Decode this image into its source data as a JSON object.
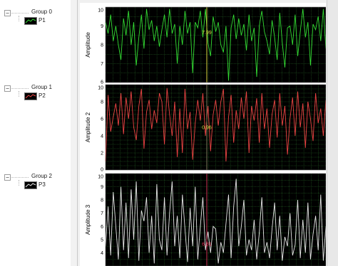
{
  "legend": {
    "groups": [
      {
        "name": "Group 0",
        "plot": "P1",
        "color": "#33dd33"
      },
      {
        "name": "Group 1",
        "plot": "P2",
        "color": "#ee4444"
      },
      {
        "name": "Group 2",
        "plot": "P3",
        "color": "#e8e8e8"
      }
    ]
  },
  "colors": {
    "plot_bg": "#000000",
    "grid": "#2a6e2a",
    "cursor_1": "#d8d840",
    "cursor_2": "#7a7a5a",
    "cursor_3": "#cc3355"
  },
  "chart_data": [
    {
      "type": "line",
      "ylabel": "Amplitude",
      "ylim": [
        6,
        10
      ],
      "yticks": [
        "10",
        "9",
        "8",
        "7",
        "6"
      ],
      "grid": true,
      "series": [
        {
          "name": "P1",
          "color": "#33dd33",
          "values": [
            9.2,
            8.6,
            9.6,
            8.2,
            9.0,
            8.0,
            7.2,
            9.4,
            8.5,
            9.8,
            8.0,
            9.2,
            6.9,
            8.4,
            9.6,
            7.8,
            9.9,
            8.8,
            9.3,
            8.2,
            9.0,
            7.9,
            8.8,
            9.6,
            8.4,
            9.9,
            8.6,
            9.1,
            7.0,
            9.0,
            8.0,
            9.8,
            8.6,
            9.2,
            6.5,
            9.2,
            8.9,
            9.8,
            8.4,
            9.9,
            8.1,
            7.4,
            9.5,
            8.7,
            9.2,
            8.0,
            7.6,
            9.0,
            6.1,
            8.9,
            9.6,
            8.3,
            9.4,
            8.5,
            9.1,
            7.7,
            9.6,
            8.2,
            8.9,
            6.3,
            9.0,
            9.8,
            8.7,
            8.2,
            7.5,
            9.3,
            8.4,
            7.2,
            9.7,
            8.1,
            6.8,
            8.9,
            9.0,
            8.0,
            9.6,
            7.4,
            8.7,
            9.9,
            8.4,
            9.2,
            6.9,
            9.1,
            8.8,
            9.5,
            8.2,
            9.9,
            7.8
          ]
        }
      ],
      "cursor": {
        "value": "7.99"
      }
    },
    {
      "type": "line",
      "ylabel": "Amplitude 2",
      "ylim": [
        0,
        10
      ],
      "yticks": [
        "10",
        "8",
        "6",
        "4",
        "2",
        "0"
      ],
      "grid": true,
      "series": [
        {
          "name": "P2",
          "color": "#ee4444",
          "values": [
            1.0,
            8.8,
            4.5,
            6.2,
            7.8,
            5.2,
            9.0,
            4.2,
            8.5,
            6.0,
            9.2,
            5.0,
            3.5,
            7.5,
            9.5,
            2.5,
            6.8,
            8.2,
            4.8,
            7.0,
            5.5,
            9.0,
            8.0,
            3.0,
            9.6,
            6.5,
            4.0,
            8.0,
            1.5,
            7.2,
            2.0,
            9.5,
            4.8,
            6.8,
            1.2,
            5.5,
            8.2,
            5.8,
            9.0,
            4.0,
            7.5,
            2.2,
            6.5,
            8.2,
            5.2,
            8.0,
            9.5,
            1.0,
            6.2,
            8.8,
            3.2,
            7.0,
            4.8,
            8.5,
            6.0,
            9.2,
            2.0,
            7.5,
            5.8,
            8.4,
            3.2,
            9.0,
            4.8,
            7.2,
            2.6,
            6.5,
            8.2,
            3.8,
            9.0,
            5.2,
            7.5,
            1.8,
            6.0,
            8.5,
            4.0,
            9.2,
            5.0,
            7.8,
            2.6,
            8.0,
            6.0,
            3.4,
            9.0,
            5.5,
            7.2,
            4.0,
            8.2
          ]
        }
      ],
      "cursor": {
        "value": "0.96"
      }
    },
    {
      "type": "line",
      "ylabel": "Amplitude 3",
      "ylim": [
        3,
        10
      ],
      "yticks": [
        "10",
        "9",
        "8",
        "7",
        "6",
        "5",
        "4"
      ],
      "grid": true,
      "series": [
        {
          "name": "P3",
          "color": "#e8e8e8",
          "values": [
            4.5,
            7.5,
            3.8,
            8.6,
            6.0,
            3.5,
            9.0,
            4.2,
            7.8,
            3.6,
            8.8,
            5.0,
            9.4,
            3.4,
            7.2,
            6.4,
            8.2,
            4.0,
            6.8,
            3.2,
            9.2,
            5.0,
            4.2,
            8.2,
            3.8,
            7.0,
            9.4,
            4.5,
            6.8,
            3.6,
            8.4,
            5.8,
            3.3,
            7.4,
            4.5,
            9.0,
            3.5,
            6.0,
            8.2,
            4.2,
            5.6,
            4.0,
            6.0,
            5.8,
            3.2,
            4.8,
            4.0,
            6.2,
            8.4,
            3.6,
            7.5,
            9.6,
            4.5,
            6.0,
            8.0,
            3.8,
            5.0,
            4.2,
            6.5,
            3.5,
            5.5,
            8.2,
            4.0,
            4.8,
            3.6,
            5.8,
            7.8,
            4.2,
            6.8,
            3.4,
            5.2,
            4.5,
            7.0,
            3.8,
            4.6,
            8.0,
            3.6,
            6.5,
            4.0,
            7.8,
            3.5,
            5.4,
            6.8,
            4.2,
            8.4,
            3.4,
            6.0
          ]
        }
      ],
      "cursor": {
        "value": "6.81"
      }
    }
  ]
}
